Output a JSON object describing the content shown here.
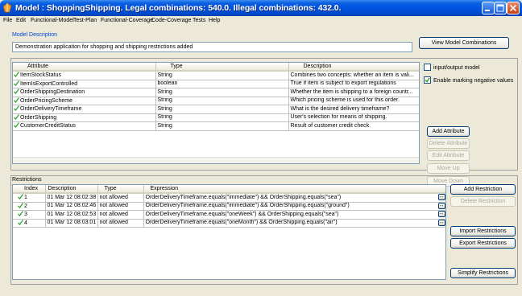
{
  "window": {
    "title": "Model : ShoppingShipping. Legal combinations: 540.0. Illegal combinations: 432.0."
  },
  "menu": [
    "File",
    "Edit",
    "Functional-Model",
    "Test-Plan",
    "Functional-Coverage",
    "Code-Coverage",
    "Tests",
    "Help"
  ],
  "model": {
    "description_label": "Model Description",
    "description_value": "Demonstration application for shopping and shipping restrictions added",
    "view_combinations_label": "View Model Combinations"
  },
  "attributes": {
    "columns": [
      "Attribute",
      "Type",
      "Description"
    ],
    "rows": [
      {
        "name": "ItemStockStatus",
        "type": "String",
        "description": "Combines two concepts: whether an item is vali..."
      },
      {
        "name": "ItemIsExportControlled",
        "type": "boolean",
        "description": "True if item is subject to export regulations"
      },
      {
        "name": "OrderShippingDestination",
        "type": "String",
        "description": "Whether the item is shipping to a foreign countr..."
      },
      {
        "name": "OrderPricingScheme",
        "type": "String",
        "description": "Which pricing scheme is used for this order."
      },
      {
        "name": "OrderDeliveryTimeframe",
        "type": "String",
        "description": "What is the desired delivery timeframe?"
      },
      {
        "name": "OrderShipping",
        "type": "String",
        "description": "User's selection for means of shipping."
      },
      {
        "name": "CustomerCreditStatus",
        "type": "String",
        "description": "Result of customer credit check."
      }
    ],
    "options": {
      "io_model_label": "input/output model",
      "io_model_checked": false,
      "negative_values_label": "Enable marking negative values",
      "negative_values_checked": true
    },
    "buttons": {
      "add": "Add Attribute",
      "delete": "Delete Attribute",
      "edit": "Edit Attribute",
      "up": "Move Up",
      "down": "Move Down"
    }
  },
  "restrictions": {
    "label": "Restrictions",
    "columns": [
      "Index",
      "Description",
      "Type",
      "Expression"
    ],
    "rows": [
      {
        "index": "1",
        "description": "01 Mar 12 08:02:38 0",
        "type": "not allowed",
        "expression": "OrderDeliveryTimeframe.equals(\"immediate\") && OrderShipping.equals(\"sea\")"
      },
      {
        "index": "2",
        "description": "01 Mar 12 08:02:46 0",
        "type": "not allowed",
        "expression": "OrderDeliveryTimeframe.equals(\"immediate\") && OrderShipping.equals(\"ground\")"
      },
      {
        "index": "3",
        "description": "01 Mar 12 08:02:53 0",
        "type": "not allowed",
        "expression": "OrderDeliveryTimeframe.equals(\"oneWeek\") && OrderShipping.equals(\"sea\")"
      },
      {
        "index": "4",
        "description": "01 Mar 12 08:03:01 0",
        "type": "not allowed",
        "expression": "OrderDeliveryTimeframe.equals(\"oneMonth\") && OrderShipping.equals(\"air\")"
      }
    ],
    "ellipsis": "...",
    "buttons": {
      "add": "Add Restriction",
      "delete": "Delete Restriction",
      "import": "Import Restrictions",
      "export": "Export Restrictions",
      "simplify": "Simplify Restrictions"
    }
  },
  "icons": {
    "row_status": "green-check-icon",
    "app": "app-icon",
    "minimize": "minimize-icon",
    "maximize": "maximize-icon",
    "close": "close-icon"
  },
  "colors": {
    "titlebar": "#0054e3",
    "section_label": "#0046d5",
    "check": "#2fa52f"
  }
}
